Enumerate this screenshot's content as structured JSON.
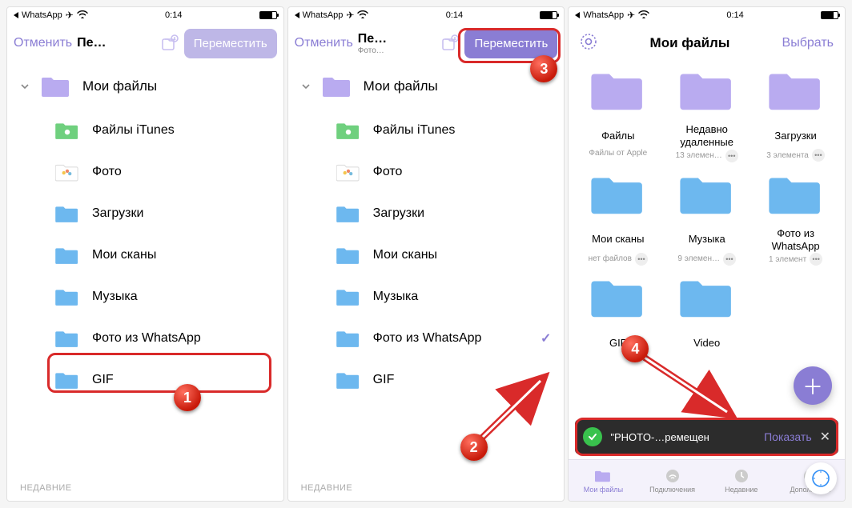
{
  "status": {
    "back_app": "WhatsApp",
    "time": "0:14"
  },
  "screen1": {
    "cancel": "Отменить",
    "title": "Пе…",
    "move": "Переместить",
    "root": "Мои файлы",
    "items": [
      "Файлы iTunes",
      "Фото",
      "Загрузки",
      "Мои сканы",
      "Музыка",
      "Фото из  WhatsApp",
      "GIF"
    ],
    "section": "НЕДАВНИЕ"
  },
  "screen2": {
    "cancel": "Отменить",
    "title": "Пе…",
    "subtitle": "Фото…",
    "move": "Переместить",
    "root": "Мои файлы",
    "items": [
      "Файлы iTunes",
      "Фото",
      "Загрузки",
      "Мои сканы",
      "Музыка",
      "Фото из  WhatsApp",
      "GIF"
    ],
    "section": "НЕДАВНИЕ"
  },
  "screen3": {
    "title": "Мои файлы",
    "select": "Выбрать",
    "tiles": [
      {
        "name": "Файлы",
        "sub": "Файлы от Apple"
      },
      {
        "name": "Недавно удаленные",
        "sub": "13 элемен…"
      },
      {
        "name": "Загрузки",
        "sub": "3 элемента"
      },
      {
        "name": "Мои сканы",
        "sub": "нет файлов"
      },
      {
        "name": "Музыка",
        "sub": "9 элемен…"
      },
      {
        "name": "Фото из WhatsApp",
        "sub": "1 элемент"
      },
      {
        "name": "GIF",
        "sub": ""
      },
      {
        "name": "Video",
        "sub": ""
      }
    ],
    "toast": {
      "text": "\"PHOTO-…ремещен",
      "show": "Показать"
    },
    "nav": [
      "Мои файлы",
      "Подключения",
      "Недавние",
      "Дополнения"
    ]
  },
  "badges": {
    "1": "1",
    "2": "2",
    "3": "3",
    "4": "4"
  }
}
